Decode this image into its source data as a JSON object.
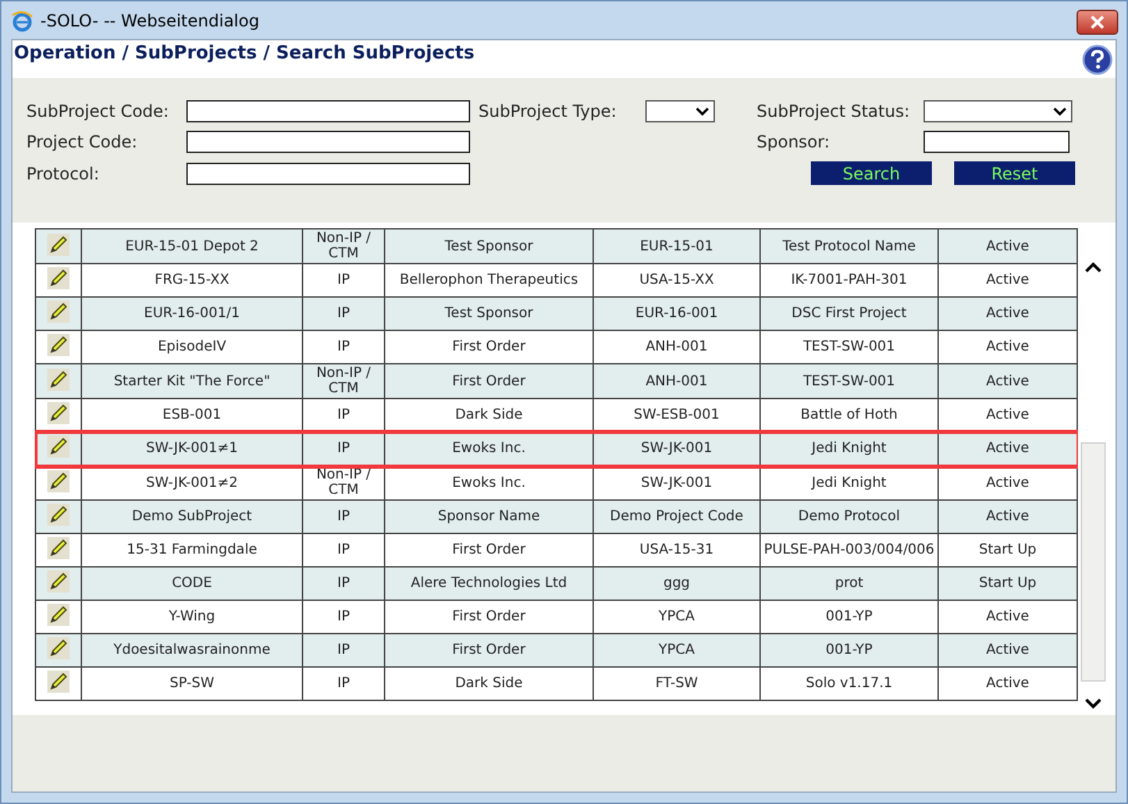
{
  "window": {
    "title": "-SOLO- -- Webseitendialog"
  },
  "page_title": "Operation / SubProjects / Search SubProjects",
  "search_form": {
    "subproject_code": {
      "label": "SubProject Code:"
    },
    "subproject_type": {
      "label": "SubProject Type:"
    },
    "subproject_status": {
      "label": "SubProject Status:"
    },
    "project_code": {
      "label": "Project Code:"
    },
    "sponsor": {
      "label": "Sponsor:"
    },
    "protocol": {
      "label": "Protocol:"
    },
    "buttons": [
      "Search",
      "Reset"
    ]
  },
  "table": {
    "rows": [
      {
        "selected": false,
        "cells": [
          "EUR-15-01 Depot 2",
          "Non-IP / CTM",
          "Test Sponsor",
          "EUR-15-01",
          "Test Protocol Name",
          "Active"
        ]
      },
      {
        "selected": false,
        "cells": [
          "FRG-15-XX",
          "IP",
          "Bellerophon Therapeutics",
          "USA-15-XX",
          "IK-7001-PAH-301",
          "Active"
        ]
      },
      {
        "selected": false,
        "cells": [
          "EUR-16-001/1",
          "IP",
          "Test Sponsor",
          "EUR-16-001",
          "DSC First Project",
          "Active"
        ]
      },
      {
        "selected": false,
        "cells": [
          "EpisodeIV",
          "IP",
          "First Order",
          "ANH-001",
          "TEST-SW-001",
          "Active"
        ]
      },
      {
        "selected": false,
        "cells": [
          "Starter Kit \"The Force\"",
          "Non-IP / CTM",
          "First Order",
          "ANH-001",
          "TEST-SW-001",
          "Active"
        ]
      },
      {
        "selected": false,
        "cells": [
          "ESB-001",
          "IP",
          "Dark Side",
          "SW-ESB-001",
          "Battle of Hoth",
          "Active"
        ]
      },
      {
        "selected": true,
        "cells": [
          "SW-JK-001≠1",
          "IP",
          "Ewoks Inc.",
          "SW-JK-001",
          "Jedi Knight",
          "Active"
        ]
      },
      {
        "selected": false,
        "cells": [
          "SW-JK-001≠2",
          "Non-IP / CTM",
          "Ewoks Inc.",
          "SW-JK-001",
          "Jedi Knight",
          "Active"
        ]
      },
      {
        "selected": false,
        "cells": [
          "Demo SubProject",
          "IP",
          "Sponsor Name",
          "Demo Project Code",
          "Demo Protocol",
          "Active"
        ]
      },
      {
        "selected": false,
        "cells": [
          "15-31 Farmingdale",
          "IP",
          "First Order",
          "USA-15-31",
          "PULSE-PAH-003/004/006",
          "Start Up"
        ]
      },
      {
        "selected": false,
        "cells": [
          "CODE",
          "IP",
          "Alere Technologies Ltd",
          "ggg",
          "prot",
          "Start Up"
        ]
      },
      {
        "selected": false,
        "cells": [
          "Y-Wing",
          "IP",
          "First Order",
          "YPCA",
          "001-YP",
          "Active"
        ]
      },
      {
        "selected": false,
        "cells": [
          "Ydoesitalwasrainonme",
          "IP",
          "First Order",
          "YPCA",
          "001-YP",
          "Active"
        ]
      },
      {
        "selected": false,
        "cells": [
          "SP-SW",
          "IP",
          "Dark Side",
          "FT-SW",
          "Solo v1.17.1",
          "Active"
        ]
      }
    ]
  }
}
